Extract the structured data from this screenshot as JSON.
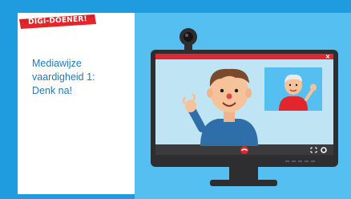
{
  "badge": {
    "label": "DIGI-DOENER!"
  },
  "lesson": {
    "title": "Mediawijze\nvaardigheid 1:\nDenk na!"
  },
  "icons": {
    "webcam": "webcam-icon",
    "hangup": "phone-hangup-icon",
    "fullscreen": "fullscreen-icon",
    "settings": "settings-icon",
    "close": "close-icon"
  },
  "colors": {
    "frame": "#1f9be0",
    "scene_bg": "#55bff2",
    "badge_red": "#e3262b",
    "title": "#1f7bb8",
    "call_bg": "#bfe4f4",
    "topbar_red": "#e3262b",
    "monitor": "#2e2e30",
    "hangup": "#e3262b"
  }
}
